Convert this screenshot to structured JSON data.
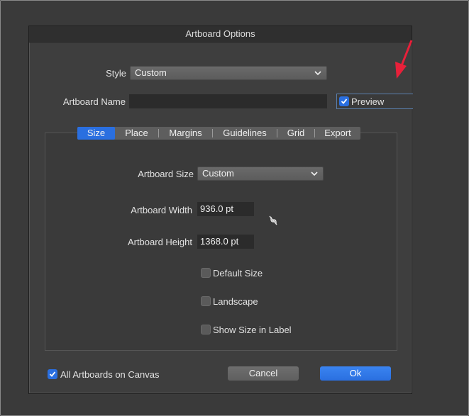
{
  "dialog": {
    "title": "Artboard Options"
  },
  "style": {
    "label": "Style",
    "value": "Custom"
  },
  "artboard_name": {
    "label": "Artboard Name",
    "value": ""
  },
  "preview": {
    "label": "Preview",
    "checked": true
  },
  "tabs": [
    {
      "label": "Size",
      "active": true
    },
    {
      "label": "Place",
      "active": false
    },
    {
      "label": "Margins",
      "active": false
    },
    {
      "label": "Guidelines",
      "active": false
    },
    {
      "label": "Grid",
      "active": false
    },
    {
      "label": "Export",
      "active": false
    }
  ],
  "size": {
    "artboard_size_label": "Artboard Size",
    "artboard_size_value": "Custom",
    "width_label": "Artboard Width",
    "width_value": "936.0 pt",
    "height_label": "Artboard Height",
    "height_value": "1368.0 pt",
    "link_icon": "unlinked-chain-icon",
    "default_size_label": "Default Size",
    "landscape_label": "Landscape",
    "show_size_label": "Show Size in Label"
  },
  "footer": {
    "all_artboards_label": "All Artboards on Canvas",
    "all_artboards_checked": true,
    "cancel_label": "Cancel",
    "ok_label": "Ok"
  },
  "colors": {
    "accent": "#2a6fe0",
    "annotation_arrow": "#e8203a"
  }
}
